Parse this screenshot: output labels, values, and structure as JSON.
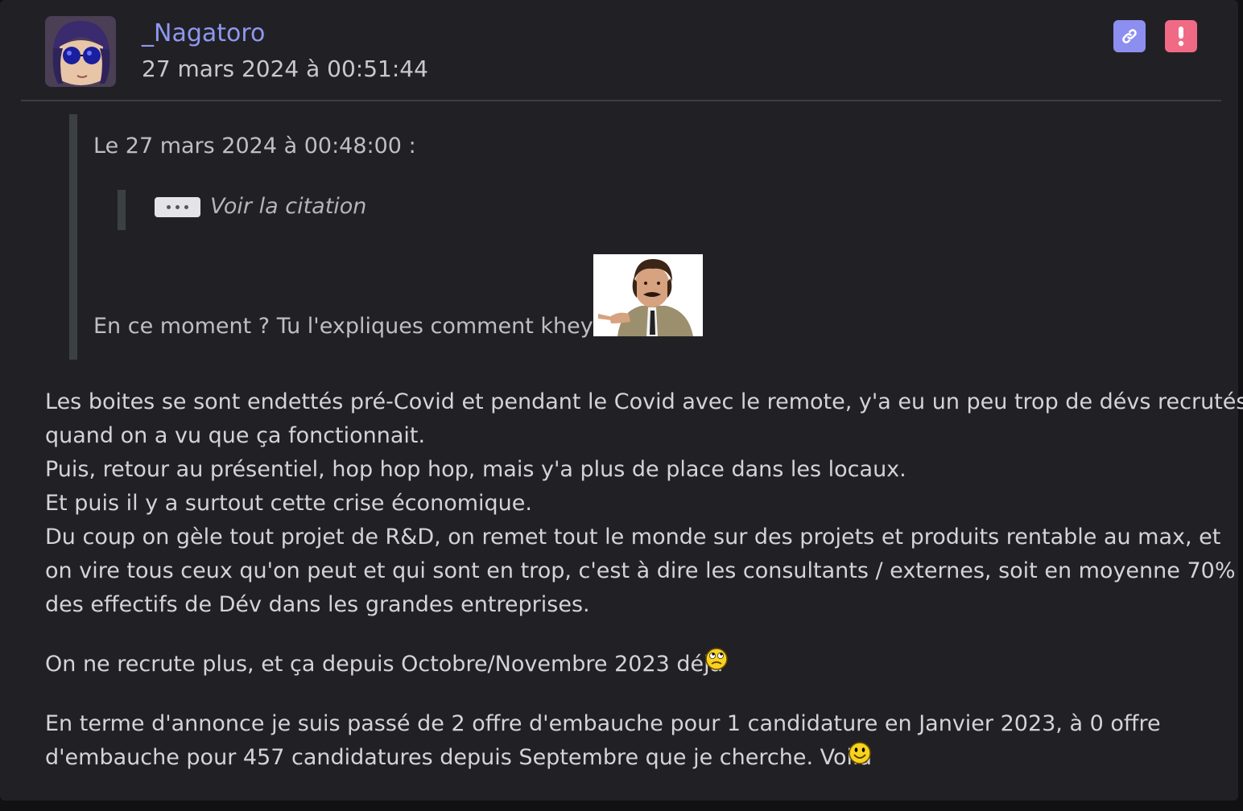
{
  "author": {
    "username": "_Nagatoro",
    "date": "27 mars 2024 à 00:51:44"
  },
  "actions": {
    "permalink_icon": "link-icon",
    "report_icon": "exclamation-icon",
    "permalink_color": "#8c8ff0",
    "report_color": "#f06a86"
  },
  "quote": {
    "header": "Le 27 mars 2024 à 00:48:00 :",
    "nested_toggle_label": "Voir la citation",
    "text": "En ce moment ? Tu l'expliques comment khey ?",
    "sticker": "man-with-mustache-pointing-sticker"
  },
  "body": {
    "paragraph1": [
      "Les boites se sont endettés pré-Covid et pendant le Covid avec le remote, y'a eu un peu trop de dévs recrutés",
      "quand on a vu que ça fonctionnait.",
      "Puis, retour au présentiel, hop hop hop, mais y'a plus de place dans les locaux.",
      "Et puis il y a surtout cette crise économique.",
      "Du coup on gèle tout projet de R&D, on remet tout le monde sur des projets et produits rentable au max, et",
      "on vire tous ceux qu'on peut et qui sont en trop, c'est à dire les consultants / externes, soit en moyenne 70%",
      "des effectifs de Dév dans les grandes entreprises."
    ],
    "paragraph2": "On ne recrute plus, et ça depuis Octobre/Novembre 2023 déjà",
    "paragraph2_smiley": "rolling-eyes-smiley",
    "paragraph3": [
      "En terme d'annonce je suis passé de 2 offre d'embauche pour 1 candidature en Janvier 2023, à 0 offre",
      "d'embauche pour 457 candidatures depuis Septembre que je cherche. Voilà"
    ],
    "paragraph3_smiley": "happy-smiley"
  }
}
